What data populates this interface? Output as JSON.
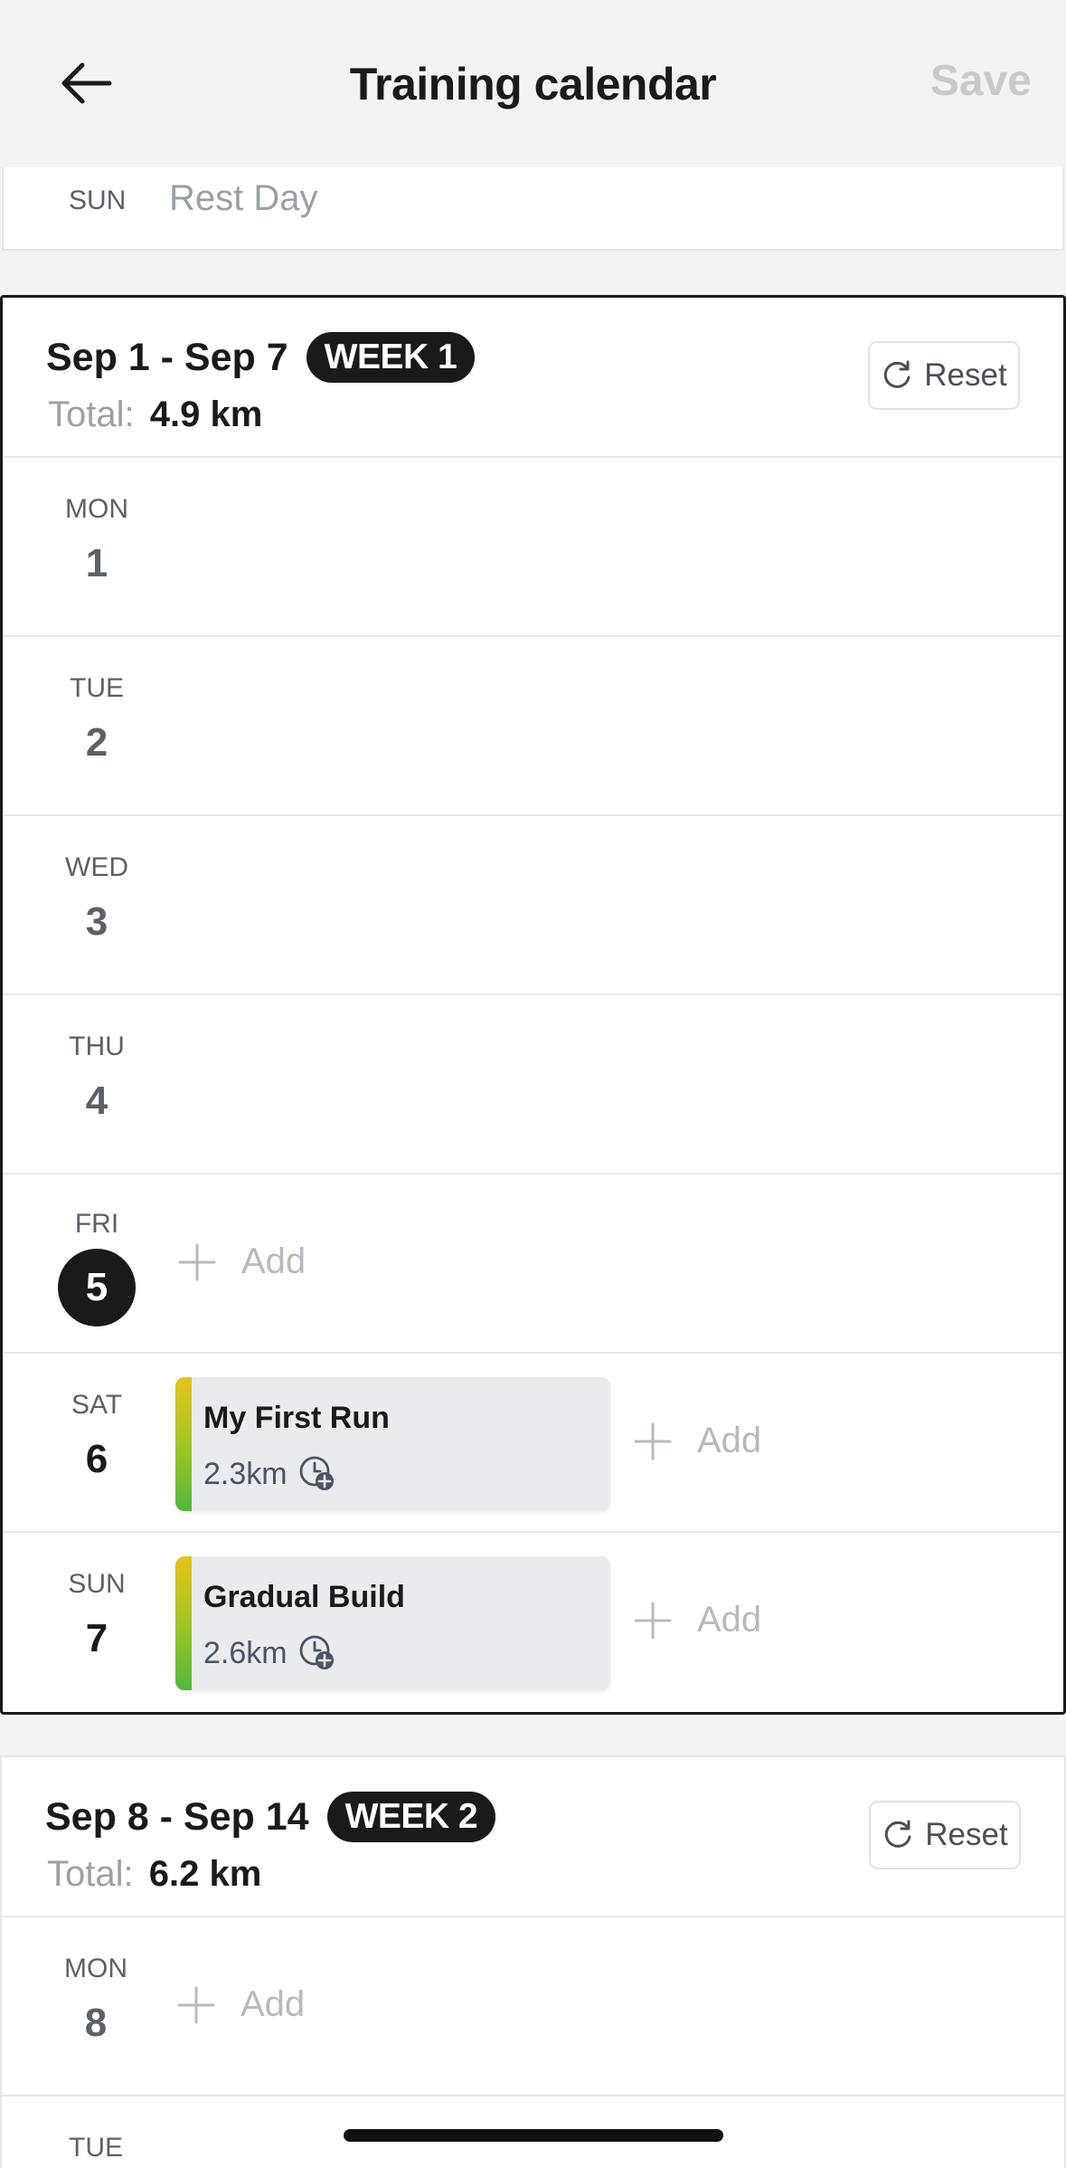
{
  "header": {
    "title": "Training calendar",
    "save_label": "Save",
    "back_icon": "arrow-left-icon"
  },
  "prev_week_tail": {
    "dow": "SUN",
    "label": "Rest Day"
  },
  "weeks": [
    {
      "range": "Sep 1 - Sep 7",
      "badge": "WEEK 1",
      "total_label": "Total:",
      "total_value": "4.9 km",
      "reset_label": "Reset",
      "days": [
        {
          "dow": "MON",
          "date": "1"
        },
        {
          "dow": "TUE",
          "date": "2"
        },
        {
          "dow": "WED",
          "date": "3"
        },
        {
          "dow": "THU",
          "date": "4"
        },
        {
          "dow": "FRI",
          "date": "5",
          "today": true,
          "add_label": "Add"
        },
        {
          "dow": "SAT",
          "date": "6",
          "workout": {
            "name": "My First Run",
            "distance": "2.3km"
          },
          "add_label": "Add"
        },
        {
          "dow": "SUN",
          "date": "7",
          "workout": {
            "name": "Gradual Build",
            "distance": "2.6km"
          },
          "add_label": "Add"
        }
      ]
    },
    {
      "range": "Sep 8 - Sep 14",
      "badge": "WEEK 2",
      "total_label": "Total:",
      "total_value": "6.2 km",
      "reset_label": "Reset",
      "days": [
        {
          "dow": "MON",
          "date": "8",
          "add_label": "Add"
        },
        {
          "dow": "TUE",
          "date": ""
        }
      ]
    }
  ],
  "colors": {
    "accent_dark": "#1a1a1a",
    "muted_text": "#9aa0a8",
    "workout_bar_top": "#e5c31d",
    "workout_bar_bottom": "#52b83b"
  }
}
